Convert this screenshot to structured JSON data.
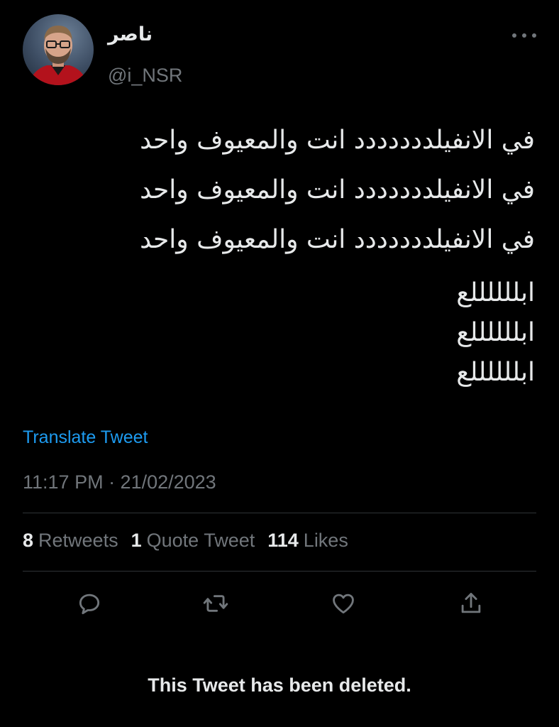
{
  "author": {
    "display_name": "ناصر",
    "handle": "@i_NSR"
  },
  "tweet": {
    "lines": [
      "في الانفيلددددددد انت والمعيوف واحد",
      "في الانفيلددددددد انت والمعيوف واحد",
      "في الانفيلددددددد انت والمعيوف واحد",
      "ابللللللع",
      "ابللللللع",
      "ابللللللع"
    ],
    "translate_label": "Translate Tweet",
    "timestamp": "11:17 PM · 21/02/2023"
  },
  "stats": {
    "retweets_count": "8",
    "retweets_label": "Retweets",
    "quotes_count": "1",
    "quotes_label": "Quote Tweet",
    "likes_count": "114",
    "likes_label": "Likes"
  },
  "actions": {
    "reply_icon": "reply-icon",
    "retweet_icon": "retweet-icon",
    "like_icon": "heart-icon",
    "share_icon": "share-icon"
  },
  "notice": {
    "deleted_text": "This Tweet has been deleted."
  },
  "colors": {
    "background": "#000000",
    "text_primary": "#e7e9ea",
    "text_secondary": "#71767b",
    "accent": "#1d9bf0",
    "divider": "#2f3336"
  }
}
